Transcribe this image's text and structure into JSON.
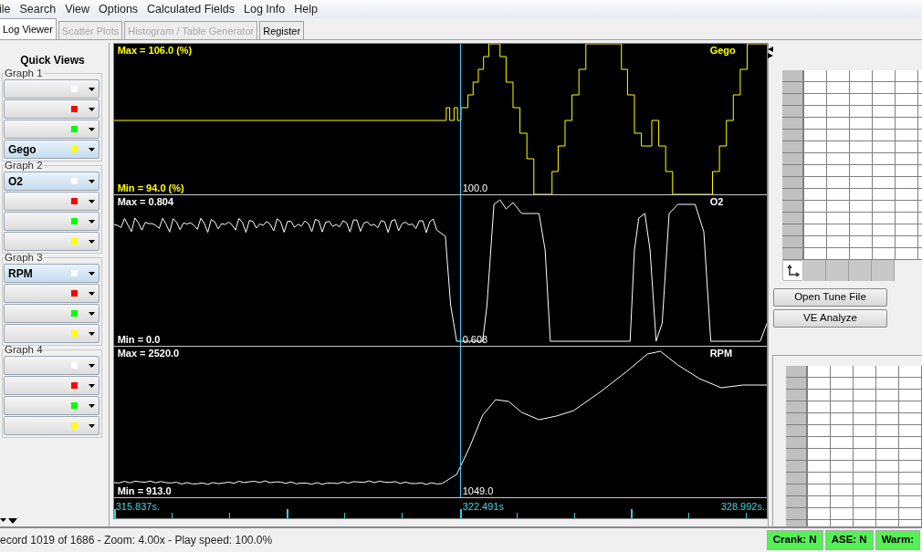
{
  "menu": [
    "ile",
    "Search",
    "View",
    "Options",
    "Calculated Fields",
    "Log Info",
    "Help"
  ],
  "tabs": [
    {
      "label": "Log Viewer",
      "selected": true,
      "disabled": false
    },
    {
      "label": "Scatter Plots",
      "selected": false,
      "disabled": true
    },
    {
      "label": "Histogram / Table Generator",
      "selected": false,
      "disabled": true
    },
    {
      "label": "Register",
      "selected": false,
      "disabled": false
    }
  ],
  "quick_views": {
    "title": "Quick Views",
    "graphs": [
      {
        "label": "Graph 1",
        "slots": [
          {
            "color": "#ffffff"
          },
          {
            "color": "#ff0000"
          },
          {
            "color": "#00ff00"
          },
          {
            "value": "Gego",
            "color": "#ffff00"
          }
        ]
      },
      {
        "label": "Graph 2",
        "slots": [
          {
            "value": "O2",
            "color": "#ffffff"
          },
          {
            "color": "#ff0000"
          },
          {
            "color": "#00ff00"
          },
          {
            "color": "#ffff00"
          }
        ]
      },
      {
        "label": "Graph 3",
        "slots": [
          {
            "value": "RPM",
            "color": "#ffffff"
          },
          {
            "color": "#ff0000"
          },
          {
            "color": "#00ff00"
          },
          {
            "color": "#ffff00"
          }
        ]
      },
      {
        "label": "Graph 4",
        "slots": [
          {
            "color": "#ffffff"
          },
          {
            "color": "#ff0000"
          },
          {
            "color": "#00ff00"
          },
          {
            "color": "#ffff00"
          }
        ]
      }
    ]
  },
  "graphs": [
    {
      "kind": "gego",
      "name": "Gego",
      "color": "#ffff00",
      "max": "Max = 106.0 (%)",
      "min": "Min = 94.0 (%)",
      "cursor_value": "100.0"
    },
    {
      "kind": "o2",
      "name": "O2",
      "color": "#ffffff",
      "max": "Max = 0.804",
      "min": "Min = 0.0",
      "cursor_value": "0.608"
    },
    {
      "kind": "rpm",
      "name": "RPM",
      "color": "#ffffff",
      "max": "Max = 2520.0",
      "min": "Min = 913.0",
      "cursor_value": "1049.0"
    }
  ],
  "time_axis": {
    "start": "315.837s.",
    "cursor": "322.491s",
    "end": "328.992s."
  },
  "side_buttons": [
    "Open Tune File",
    "VE Analyze"
  ],
  "status": {
    "text": "ecord 1019 of 1686 - Zoom: 4.00x - Play speed: 100.0%",
    "indicators": [
      "Crank: N",
      "ASE: N",
      "Warm:"
    ]
  }
}
